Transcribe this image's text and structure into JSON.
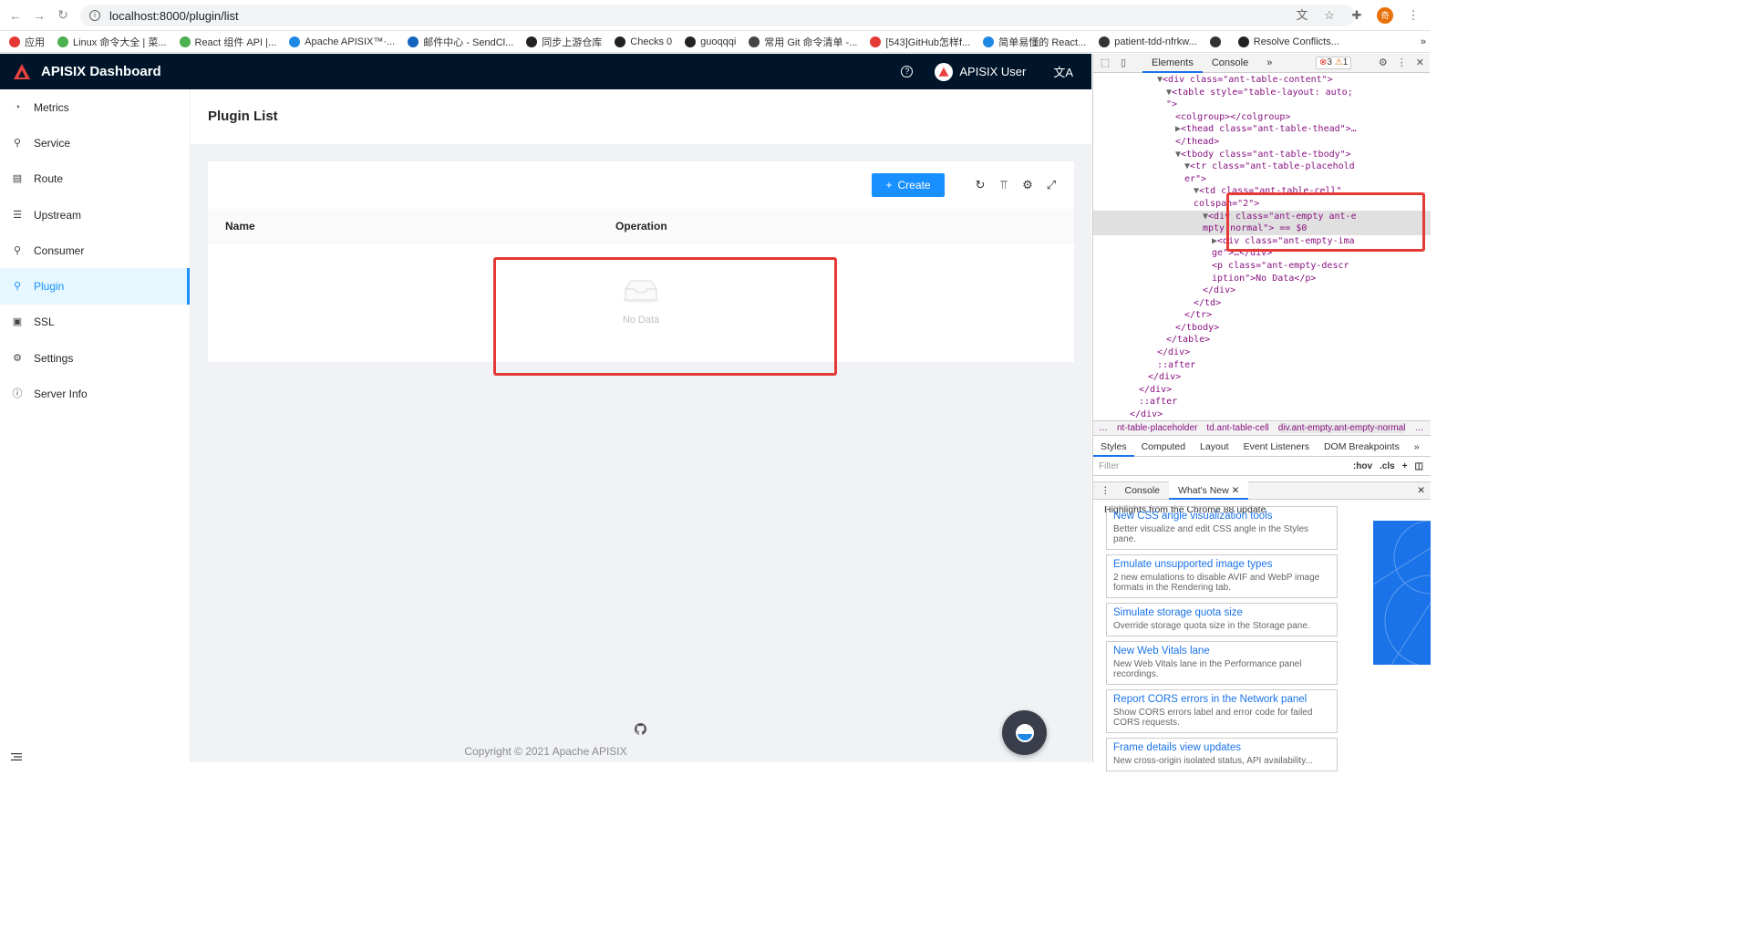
{
  "browser": {
    "url": "localhost:8000/plugin/list",
    "profile_initial": "奇",
    "bookmarks": [
      {
        "label": "应用",
        "color": "#e53935"
      },
      {
        "label": "Linux 命令大全 | 菜...",
        "color": "#4caf50"
      },
      {
        "label": "React 组件 API |...",
        "color": "#4caf50"
      },
      {
        "label": "Apache APISIX™·...",
        "color": "#1e88e5"
      },
      {
        "label": "邮件中心 - SendCl...",
        "color": "#1565c0"
      },
      {
        "label": "同步上游仓库",
        "color": "#222222"
      },
      {
        "label": "Checks 0",
        "color": "#222222"
      },
      {
        "label": "guoqqqi",
        "color": "#222222"
      },
      {
        "label": "常用 Git 命令清单 -...",
        "color": "#444444"
      },
      {
        "label": "[543]GitHub怎样f...",
        "color": "#e53935"
      },
      {
        "label": "简单易懂的 React...",
        "color": "#1e88e5"
      },
      {
        "label": "patient-tdd-nfrkw...",
        "color": "#333333"
      },
      {
        "label": "",
        "color": "#333333"
      },
      {
        "label": "Resolve Conflicts...",
        "color": "#222222"
      }
    ],
    "more_bookmarks": "»"
  },
  "app": {
    "title": "APISIX Dashboard",
    "user_name": "APISIX User",
    "help_icon": "?",
    "lang_icon": "文A",
    "menu": [
      {
        "label": "Metrics",
        "icon": "◔",
        "active": false
      },
      {
        "label": "Service",
        "icon": "⚲",
        "active": false
      },
      {
        "label": "Route",
        "icon": "▤",
        "active": false
      },
      {
        "label": "Upstream",
        "icon": "☰",
        "active": false
      },
      {
        "label": "Consumer",
        "icon": "⚲",
        "active": false
      },
      {
        "label": "Plugin",
        "icon": "⚲",
        "active": true
      },
      {
        "label": "SSL",
        "icon": "▣",
        "active": false
      },
      {
        "label": "Settings",
        "icon": "⚙",
        "active": false
      },
      {
        "label": "Server Info",
        "icon": "ⓘ",
        "active": false
      }
    ],
    "page_title": "Plugin List",
    "create_button": "Create",
    "columns": [
      "Name",
      "Operation"
    ],
    "empty_text": "No Data",
    "copyright": "Copyright © 2021 Apache APISIX",
    "accent": "#1890ff",
    "header_bg": "#001529"
  },
  "devtools": {
    "tabs": [
      "Elements",
      "Console"
    ],
    "more": "»",
    "errors": "3",
    "warnings": "1",
    "code_lines": [
      {
        "indent": 14,
        "arrow": "▼",
        "html": "<div class=\"ant-table-content\">"
      },
      {
        "indent": 16,
        "arrow": "▼",
        "html": "<table style=\"table-layout: auto;"
      },
      {
        "indent": 16,
        "arrow": "",
        "html": "\">"
      },
      {
        "indent": 18,
        "arrow": "",
        "html": "<colgroup></colgroup>"
      },
      {
        "indent": 18,
        "arrow": "▶",
        "html": "<thead class=\"ant-table-thead\">…"
      },
      {
        "indent": 18,
        "arrow": "",
        "html": "</thead>"
      },
      {
        "indent": 18,
        "arrow": "▼",
        "html": "<tbody class=\"ant-table-tbody\">"
      },
      {
        "indent": 20,
        "arrow": "▼",
        "html": "<tr class=\"ant-table-placehold"
      },
      {
        "indent": 20,
        "arrow": "",
        "html": "er\">"
      },
      {
        "indent": 22,
        "arrow": "▼",
        "html": "<td class=\"ant-table-cell\""
      },
      {
        "indent": 22,
        "arrow": "",
        "html": "colspan=\"2\">"
      },
      {
        "indent": 24,
        "arrow": "▼",
        "html": "<div class=\"ant-empty ant-e",
        "sel": true
      },
      {
        "indent": 24,
        "arrow": "",
        "html": "mpty-normal\"> == $0",
        "sel": true
      },
      {
        "indent": 26,
        "arrow": "▶",
        "html": "<div class=\"ant-empty-ima"
      },
      {
        "indent": 26,
        "arrow": "",
        "html": "ge\">…</div>"
      },
      {
        "indent": 26,
        "arrow": "",
        "html": "<p class=\"ant-empty-descr"
      },
      {
        "indent": 26,
        "arrow": "",
        "html": "iption\">No Data</p>"
      },
      {
        "indent": 24,
        "arrow": "",
        "html": "</div>"
      },
      {
        "indent": 22,
        "arrow": "",
        "html": "</td>"
      },
      {
        "indent": 20,
        "arrow": "",
        "html": "</tr>"
      },
      {
        "indent": 18,
        "arrow": "",
        "html": "</tbody>"
      },
      {
        "indent": 16,
        "arrow": "",
        "html": "</table>"
      },
      {
        "indent": 14,
        "arrow": "",
        "html": "</div>"
      },
      {
        "indent": 14,
        "arrow": "",
        "html": "::after"
      },
      {
        "indent": 12,
        "arrow": "",
        "html": "</div>"
      },
      {
        "indent": 10,
        "arrow": "",
        "html": "</div>"
      },
      {
        "indent": 10,
        "arrow": "",
        "html": "::after"
      },
      {
        "indent": 8,
        "arrow": "",
        "html": "</div>"
      }
    ],
    "crumbs": [
      "…",
      "nt-table-placeholder",
      "td.ant-table-cell",
      "div.ant-empty.ant-empty-normal",
      "…"
    ],
    "subtabs": [
      "Styles",
      "Computed",
      "Layout",
      "Event Listeners",
      "DOM Breakpoints",
      "»"
    ],
    "filter_placeholder": "Filter",
    "filter_hov": ":hov",
    "filter_cls": ".cls",
    "filter_add": "+",
    "drawer_tabs": [
      "Console",
      "What's New"
    ],
    "highlights": "Highlights from the Chrome 88 update",
    "news": [
      {
        "title": "New CSS angle visualization tools",
        "desc": "Better visualize and edit CSS angle in the Styles pane."
      },
      {
        "title": "Emulate unsupported image types",
        "desc": "2 new emulations to disable AVIF and WebP image formats in the Rendering tab."
      },
      {
        "title": "Simulate storage quota size",
        "desc": "Override storage quota size in the Storage pane."
      },
      {
        "title": "New Web Vitals lane",
        "desc": "New Web Vitals lane in the Performance panel recordings."
      },
      {
        "title": "Report CORS errors in the Network panel",
        "desc": "Show CORS errors label and error code for failed CORS requests."
      },
      {
        "title": "Frame details view updates",
        "desc": "New cross-origin isolated status, API availability..."
      }
    ]
  }
}
